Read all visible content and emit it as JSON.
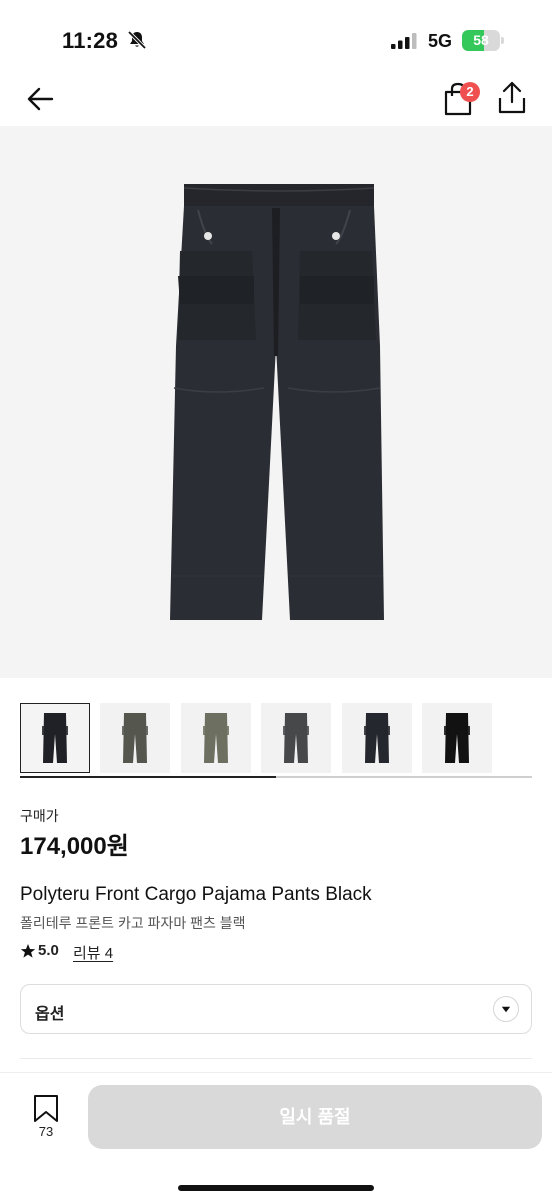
{
  "status_bar": {
    "time": "11:28",
    "network": "5G",
    "battery_percent": "58",
    "battery_level": 0.58,
    "icons": [
      "bell-slash-icon",
      "signal-icon",
      "battery-icon"
    ]
  },
  "nav": {
    "back_icon": "arrow-left-icon",
    "cart_icon": "shopping-bag-icon",
    "cart_badge": "2",
    "share_icon": "share-icon"
  },
  "gallery": {
    "progress": 0.5,
    "thumbnail_count": 6,
    "selected_index": 0,
    "thumbnail_colors": [
      "#1f2126",
      "#55574f",
      "#6d7060",
      "#47484a",
      "#24272e",
      "#121212"
    ]
  },
  "product": {
    "price_label": "구매가",
    "price": "174,000원",
    "title_en": "Polyteru Front Cargo Pajama Pants Black",
    "title_ko": "폴리테루 프론트 카고 파자마 팬츠 블랙",
    "rating": "5.0",
    "review_label": "리뷰 4"
  },
  "options": {
    "label": "옵션",
    "arrow_icon": "chevron-down-icon"
  },
  "bottom_bar": {
    "bookmark_icon": "bookmark-icon",
    "bookmark_count": "73",
    "cta_label": "일시 품절"
  },
  "colors": {
    "accent_badge": "#ef4f4f",
    "battery_green": "#34c759",
    "disabled_button": "#d9d9d9"
  }
}
